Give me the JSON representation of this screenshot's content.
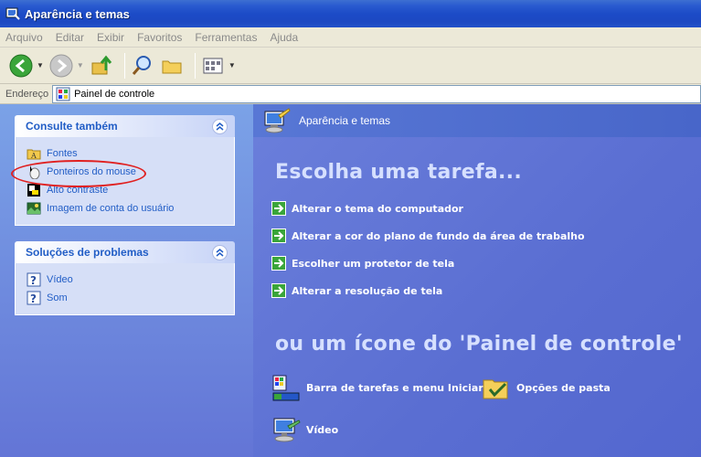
{
  "window": {
    "title": "Aparência e temas"
  },
  "menu": {
    "items": [
      "Arquivo",
      "Editar",
      "Exibir",
      "Favoritos",
      "Ferramentas",
      "Ajuda"
    ]
  },
  "address": {
    "label": "Endereço",
    "value": "Painel de controle"
  },
  "see_also": {
    "title": "Consulte também",
    "items": [
      {
        "label": "Fontes",
        "icon": "fonts-folder-icon"
      },
      {
        "label": "Ponteiros do mouse",
        "icon": "mouse-icon"
      },
      {
        "label": "Alto contraste",
        "icon": "contrast-icon"
      },
      {
        "label": "Imagem de conta do usuário",
        "icon": "user-picture-icon"
      }
    ]
  },
  "troubleshoot": {
    "title": "Soluções de problemas",
    "items": [
      {
        "label": "Vídeo",
        "icon": "help-icon"
      },
      {
        "label": "Som",
        "icon": "help-icon"
      }
    ]
  },
  "content": {
    "header": "Aparência e temas",
    "choose_task": "Escolha uma tarefa...",
    "tasks": [
      "Alterar o tema do computador",
      "Alterar a cor do plano de fundo da área de trabalho",
      "Escolher um protetor de tela",
      "Alterar a resolução de tela"
    ],
    "or_icon": "ou um ícone do 'Painel de controle'",
    "icons": [
      {
        "label": "Barra de tarefas e menu Iniciar",
        "icon": "taskbar-icon"
      },
      {
        "label": "Opções de pasta",
        "icon": "folder-options-icon"
      },
      {
        "label": "Vídeo",
        "icon": "display-icon"
      }
    ]
  },
  "colors": {
    "link": "#215dc6",
    "annotation": "#e02020",
    "heading": "#d6e0ff"
  }
}
